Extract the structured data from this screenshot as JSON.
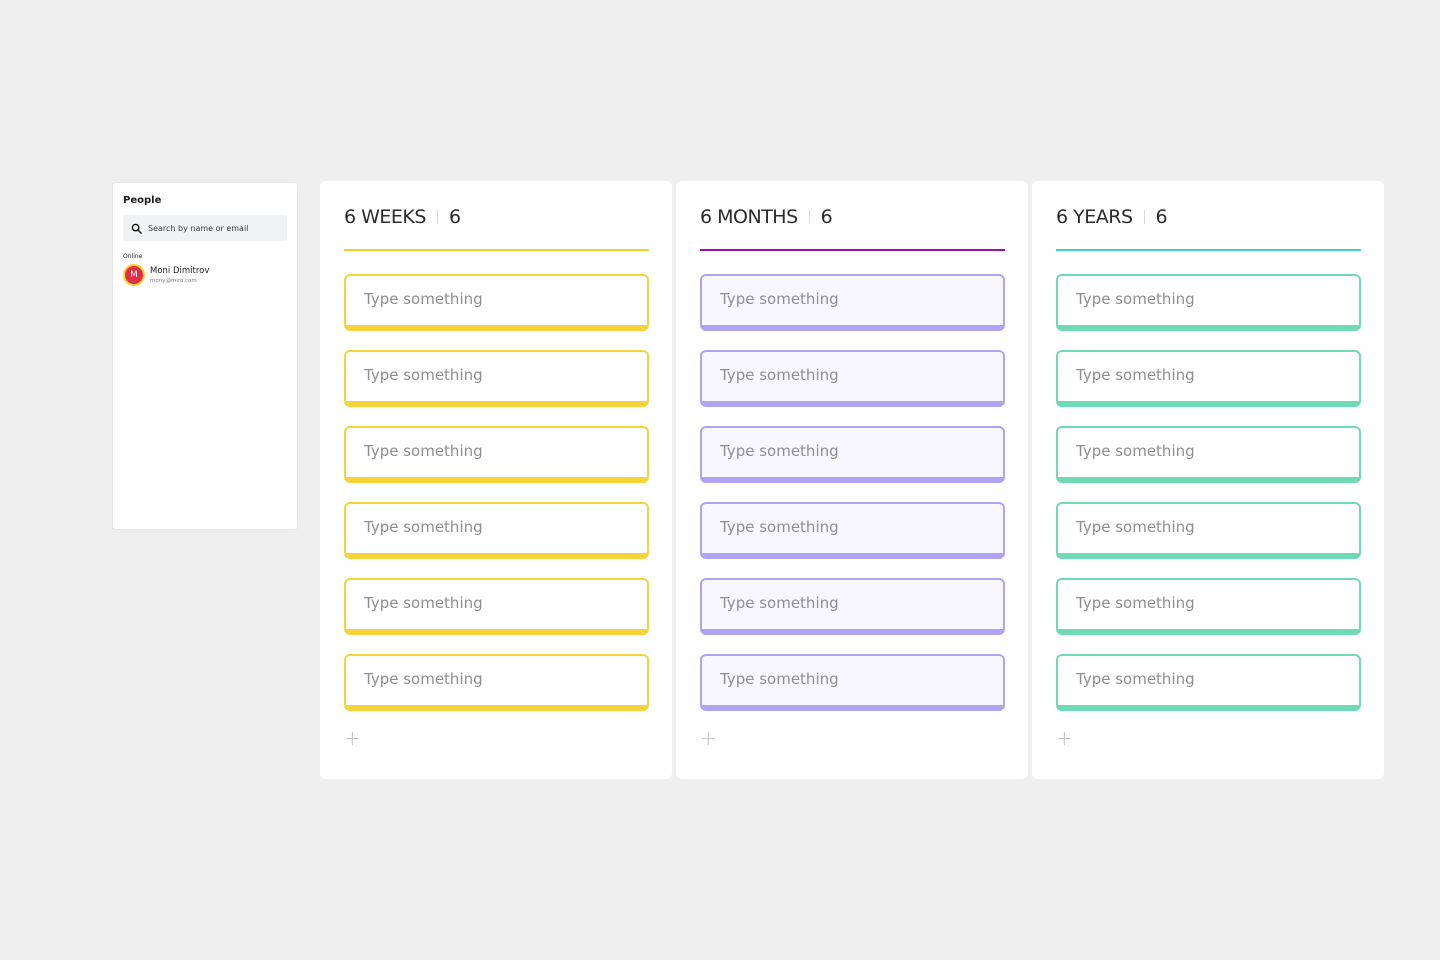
{
  "people": {
    "title": "People",
    "search_placeholder": "Search by name or email",
    "online_label": "Online",
    "users": [
      {
        "initial": "M",
        "name": "Moni Dimitrov",
        "email": "mony@miro.com"
      }
    ]
  },
  "columns": [
    {
      "title": "6 WEEKS",
      "count": "6",
      "accent": "#f5d128",
      "cards": [
        "Type something",
        "Type something",
        "Type something",
        "Type something",
        "Type something",
        "Type something"
      ],
      "add_label": "+"
    },
    {
      "title": "6 MONTHS",
      "count": "6",
      "accent": "#9812a8",
      "cards": [
        "Type something",
        "Type something",
        "Type something",
        "Type something",
        "Type something",
        "Type something"
      ],
      "add_label": "+"
    },
    {
      "title": "6 YEARS",
      "count": "6",
      "accent": "#3fd1cf",
      "cards": [
        "Type something",
        "Type something",
        "Type something",
        "Type something",
        "Type something",
        "Type something"
      ],
      "add_label": "+"
    }
  ]
}
